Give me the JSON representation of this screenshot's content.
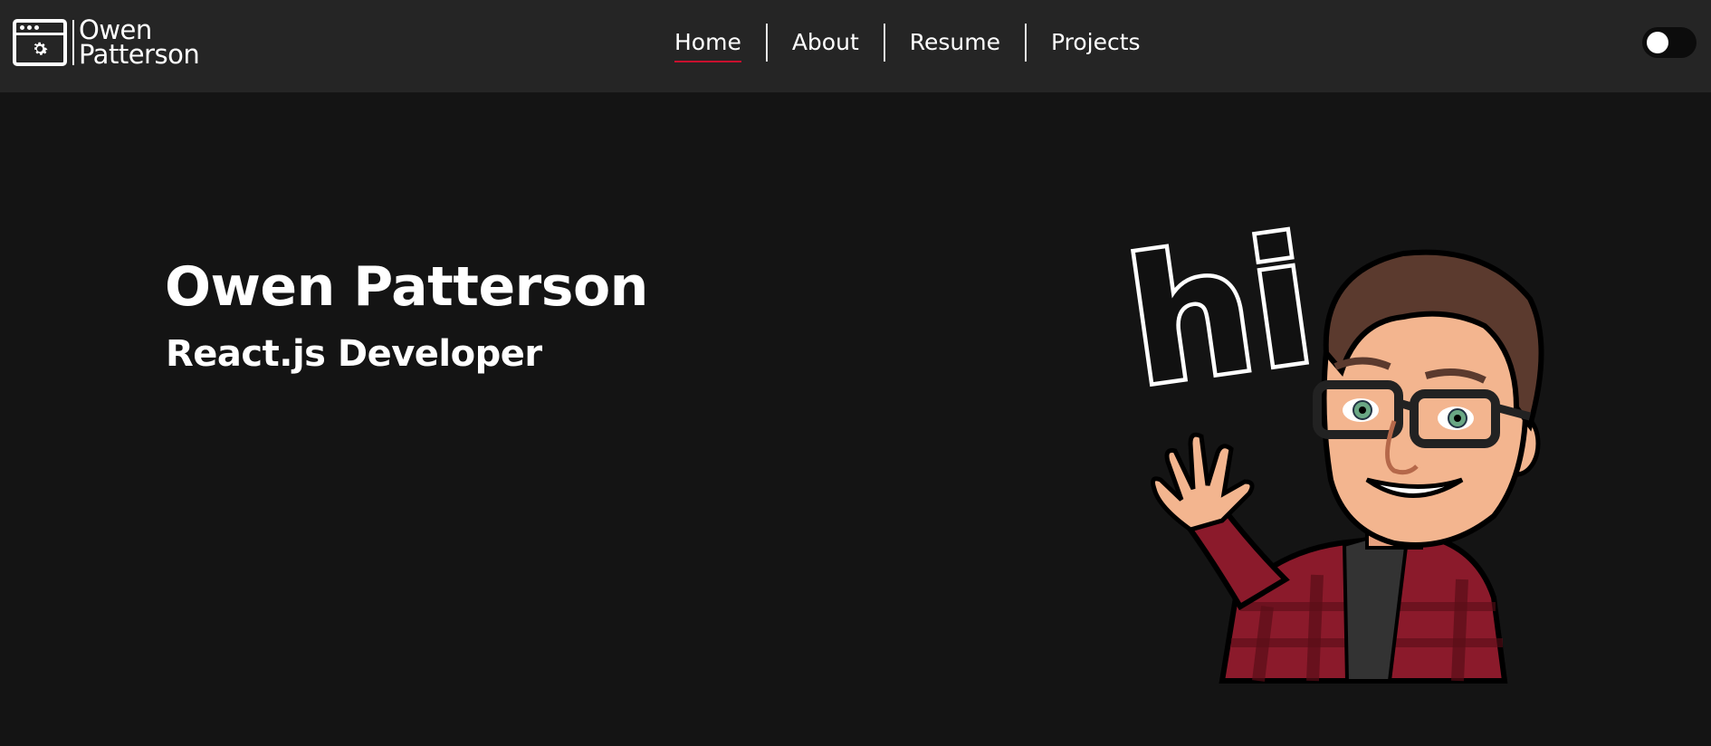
{
  "brand": {
    "line1": "Owen",
    "line2": "Patterson",
    "logo_icon": "gear-window-icon"
  },
  "nav": {
    "items": [
      {
        "label": "Home",
        "active": true
      },
      {
        "label": "About",
        "active": false
      },
      {
        "label": "Resume",
        "active": false
      },
      {
        "label": "Projects",
        "active": false
      }
    ],
    "active_underline_color": "#c8102e"
  },
  "theme_toggle": {
    "state": "off",
    "icon": "theme-toggle-switch"
  },
  "hero": {
    "name": "Owen Patterson",
    "role": "React.js Developer",
    "illustration_text": "hi"
  },
  "colors": {
    "navbar_bg": "#252525",
    "page_bg": "#141414",
    "text": "#ffffff",
    "accent": "#c8102e"
  }
}
